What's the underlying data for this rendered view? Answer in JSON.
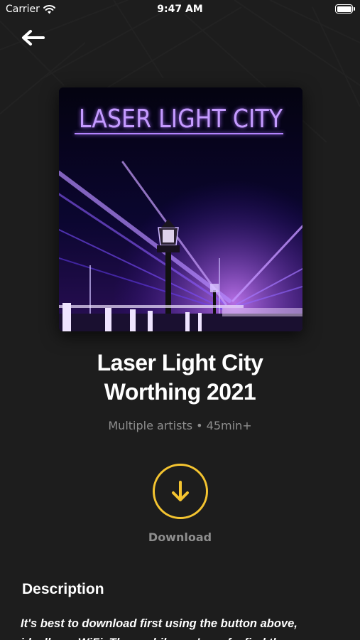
{
  "status_bar": {
    "carrier": "Carrier",
    "time": "9:47 AM"
  },
  "cover": {
    "title_text": "LASER LIGHT CITY",
    "accent_color": "#b484ff"
  },
  "event": {
    "title_line1": "Laser Light City",
    "title_line2": "Worthing 2021",
    "meta": "Multiple artists • 45min+"
  },
  "download": {
    "label": "Download",
    "accent_color": "#f4c430"
  },
  "description": {
    "heading": "Description",
    "text": "It's best to download first using the button above, ideally on WiFi. Then, while you're safe, find the event"
  },
  "icons": {
    "back": "arrow-left-icon",
    "download": "arrow-down-icon",
    "wifi": "wifi-icon",
    "battery": "battery-icon"
  }
}
